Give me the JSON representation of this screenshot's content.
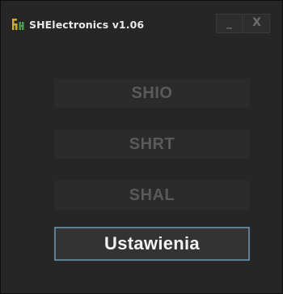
{
  "window": {
    "title": "SHElectronics v1.06",
    "app_icon": "app-logo-icon",
    "controls": {
      "minimize_label": "_",
      "close_label": "X"
    }
  },
  "menu": {
    "buttons": [
      {
        "label": "SHIO",
        "enabled": false
      },
      {
        "label": "SHRT",
        "enabled": false
      },
      {
        "label": "SHAL",
        "enabled": false
      },
      {
        "label": "Ustawienia",
        "enabled": true
      }
    ]
  },
  "colors": {
    "background": "#262626",
    "disabled_text": "#5a5a5a",
    "active_text": "#f2f2f2",
    "focus_border": "#5e7f92"
  }
}
